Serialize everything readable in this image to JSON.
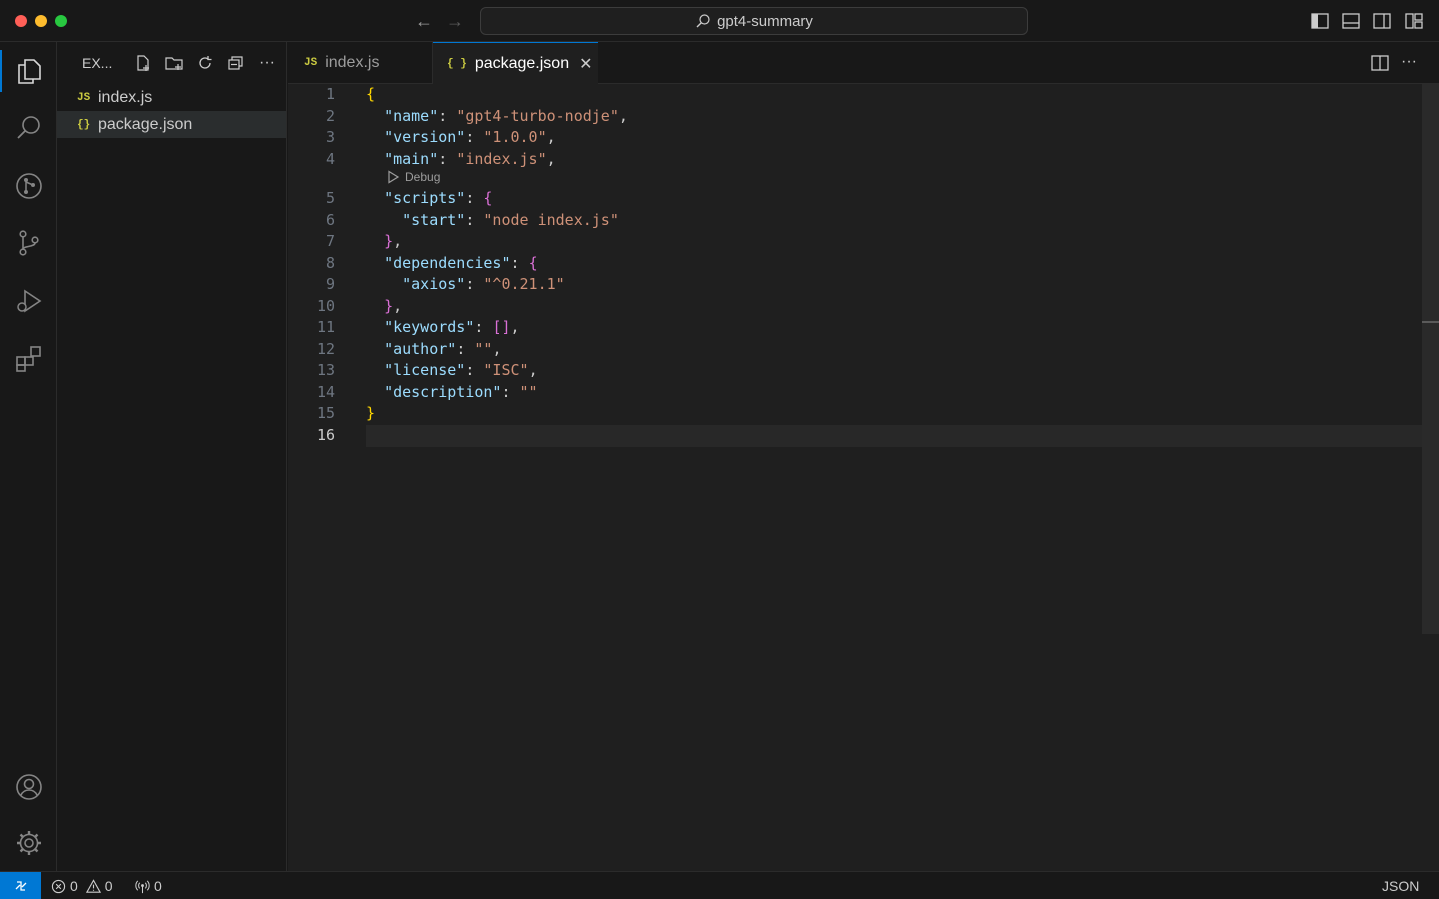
{
  "window": {
    "search_text": "gpt4-summary"
  },
  "sidebar": {
    "title": "EX...",
    "files": [
      {
        "icon": "JS",
        "name": "index.js"
      },
      {
        "icon": "{}",
        "name": "package.json"
      }
    ]
  },
  "tabs": [
    {
      "icon": "JS",
      "label": "index.js"
    },
    {
      "icon": "{ }",
      "label": "package.json",
      "close": "✕"
    }
  ],
  "editor": {
    "codelens": "Debug",
    "line_numbers": [
      "1",
      "2",
      "3",
      "4",
      "5",
      "6",
      "7",
      "8",
      "9",
      "10",
      "11",
      "12",
      "13",
      "14",
      "15",
      "16"
    ],
    "lines": [
      {
        "indent": "",
        "key": "",
        "sep": "",
        "value": "",
        "open": "{",
        "close": "",
        "tail": ""
      },
      {
        "indent": "  ",
        "key": "\"name\"",
        "sep": ": ",
        "value": "\"gpt4-turbo-nodje\"",
        "open": "",
        "close": "",
        "tail": ","
      },
      {
        "indent": "  ",
        "key": "\"version\"",
        "sep": ": ",
        "value": "\"1.0.0\"",
        "open": "",
        "close": "",
        "tail": ","
      },
      {
        "indent": "  ",
        "key": "\"main\"",
        "sep": ": ",
        "value": "\"index.js\"",
        "open": "",
        "close": "",
        "tail": ","
      },
      {
        "indent": "  ",
        "key": "\"scripts\"",
        "sep": ": ",
        "value": "",
        "open": "{",
        "close": "",
        "tail": ""
      },
      {
        "indent": "    ",
        "key": "\"start\"",
        "sep": ": ",
        "value": "\"node index.js\"",
        "open": "",
        "close": "",
        "tail": ""
      },
      {
        "indent": "  ",
        "key": "",
        "sep": "",
        "value": "",
        "open": "",
        "close": "}",
        "tail": ","
      },
      {
        "indent": "  ",
        "key": "\"dependencies\"",
        "sep": ": ",
        "value": "",
        "open": "{",
        "close": "",
        "tail": ""
      },
      {
        "indent": "    ",
        "key": "\"axios\"",
        "sep": ": ",
        "value": "\"^0.21.1\"",
        "open": "",
        "close": "",
        "tail": ""
      },
      {
        "indent": "  ",
        "key": "",
        "sep": "",
        "value": "",
        "open": "",
        "close": "}",
        "tail": ","
      },
      {
        "indent": "  ",
        "key": "\"keywords\"",
        "sep": ": ",
        "value": "",
        "open": "[]",
        "close": "",
        "tail": ","
      },
      {
        "indent": "  ",
        "key": "\"author\"",
        "sep": ": ",
        "value": "\"\"",
        "open": "",
        "close": "",
        "tail": ","
      },
      {
        "indent": "  ",
        "key": "\"license\"",
        "sep": ": ",
        "value": "\"ISC\"",
        "open": "",
        "close": "",
        "tail": ","
      },
      {
        "indent": "  ",
        "key": "\"description\"",
        "sep": ": ",
        "value": "\"\"",
        "open": "",
        "close": "",
        "tail": ""
      },
      {
        "indent": "",
        "key": "",
        "sep": "",
        "value": "",
        "open": "",
        "close": "}",
        "tail": ""
      },
      {
        "indent": "",
        "key": "",
        "sep": "",
        "value": "",
        "open": "",
        "close": "",
        "tail": ""
      }
    ],
    "current_line": 16
  },
  "statusbar": {
    "errors": "0",
    "warnings": "0",
    "ports": "0",
    "language": "JSON"
  },
  "colors": {
    "accent": "#0078d4",
    "json_key": "#9cdcfe",
    "json_string": "#ce9178",
    "bracket_level1": "#ffd700",
    "bracket_level2": "#da70d6"
  }
}
